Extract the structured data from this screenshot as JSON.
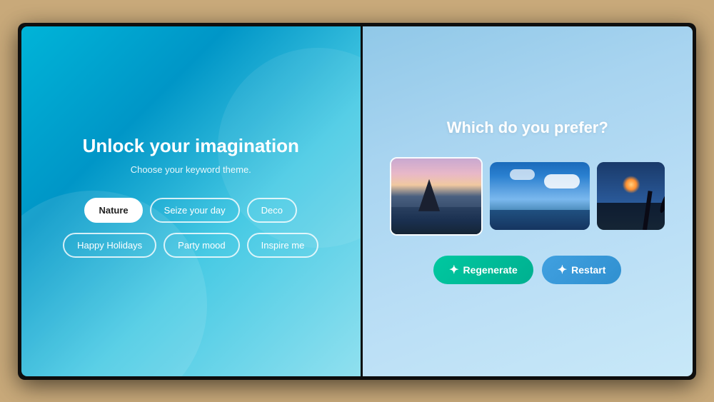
{
  "left": {
    "title": "Unlock your imagination",
    "subtitle": "Choose your keyword theme.",
    "keywords_row1": [
      {
        "id": "nature",
        "label": "Nature",
        "active": true
      },
      {
        "id": "seize",
        "label": "Seize your day",
        "active": false
      },
      {
        "id": "deco",
        "label": "Deco",
        "active": false
      }
    ],
    "keywords_row2": [
      {
        "id": "holidays",
        "label": "Happy Holidays",
        "active": false
      },
      {
        "id": "party",
        "label": "Party mood",
        "active": false
      },
      {
        "id": "inspire",
        "label": "Inspire me",
        "active": false
      }
    ]
  },
  "right": {
    "title": "Which do you prefer?",
    "images": [
      {
        "id": "beach-rocky",
        "alt": "Rocky beach at dusk"
      },
      {
        "id": "beach-blue",
        "alt": "Blue sky beach"
      },
      {
        "id": "palm-silhouette",
        "alt": "Palm tree silhouette"
      }
    ],
    "buttons": [
      {
        "id": "regenerate",
        "label": "Regenerate",
        "icon": "✦"
      },
      {
        "id": "restart",
        "label": "Restart",
        "icon": "✦"
      }
    ]
  }
}
